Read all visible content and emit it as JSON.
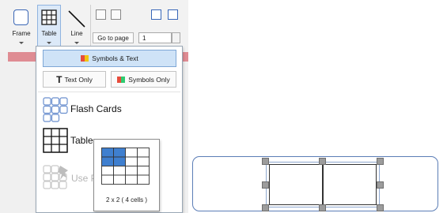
{
  "ribbon": {
    "tools": [
      {
        "label": "Frame",
        "icon": "frame-icon",
        "selected": false
      },
      {
        "label": "Table",
        "icon": "table-grid-icon",
        "selected": true
      },
      {
        "label": "Line",
        "icon": "line-tool-icon",
        "selected": false
      }
    ],
    "goto_label": "Go to page",
    "page_value": "1"
  },
  "dropdown": {
    "top_option": "Symbols & Text",
    "text_only": "Text Only",
    "symbols_only": "Symbols Only",
    "items": [
      {
        "label": "Flash Cards",
        "icon": "flash-cards-icon",
        "enabled": true
      },
      {
        "label": "Table",
        "icon": "table-icon",
        "enabled": true
      },
      {
        "label": "Use P",
        "icon": "use-pinned-icon",
        "enabled": false
      }
    ]
  },
  "table_picker": {
    "columns": 4,
    "rows": 4,
    "selected_columns": 2,
    "selected_rows": 2,
    "caption": "2 x 2   ( 4 cells )"
  },
  "colors": {
    "selection": "#dce9f8",
    "picker_fill": "#3f7fcf",
    "frame_border": "#5b7db6",
    "accent_bar": "#df8c93"
  }
}
